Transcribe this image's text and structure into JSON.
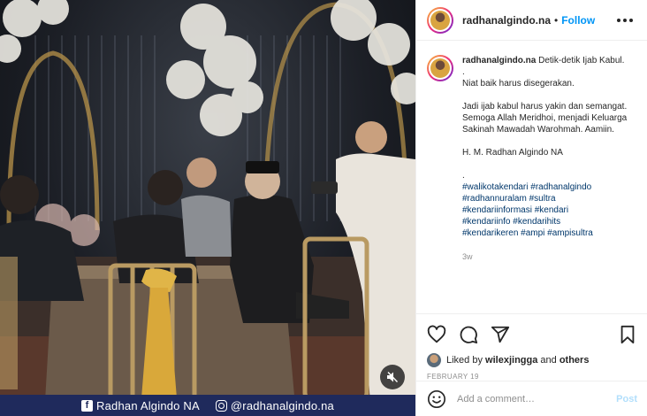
{
  "post": {
    "username": "radhanalgindo.na",
    "follow_label": "Follow",
    "caption": {
      "username": "radhanalgindo.na",
      "lines": [
        "Detik-detik Ijab Kabul.",
        ".",
        "Niat baik harus disegerakan.",
        "",
        "Jadi ijab kabul harus yakin dan semangat. Semoga Allah Meridhoi, menjadi Keluarga Sakinah Mawadah Warohmah. Aamiin.",
        "",
        "H. M. Radhan Algindo NA",
        "",
        "."
      ],
      "hashtags": [
        "#walikotakendari #radhanalgindo",
        "#radhannuralam #sultra",
        "#kendariinformasi #kendari",
        "#kendariinfo #kendarihits",
        "#kendarikeren #ampi #ampisultra"
      ],
      "age": "3w"
    },
    "likes": {
      "prefix": "Liked by",
      "user": "wilexjingga",
      "joiner": "and",
      "others": "others"
    },
    "date": "FEBRUARY 19",
    "comment": {
      "placeholder": "Add a comment…",
      "post_label": "Post"
    }
  },
  "media": {
    "watermark_facebook": "Radhan Algindo NA",
    "watermark_instagram": "@radhanalgindo.na"
  },
  "icons": {
    "more": "more-icon",
    "like": "heart-icon",
    "comment": "comment-icon",
    "share": "share-icon",
    "save": "bookmark-icon",
    "emoji": "emoji-icon",
    "mute": "mute-icon"
  },
  "colors": {
    "accent": "#0095f6",
    "link": "#00376b",
    "muted": "#8e8e8e",
    "watermark_bg": "#1f2a5c"
  }
}
